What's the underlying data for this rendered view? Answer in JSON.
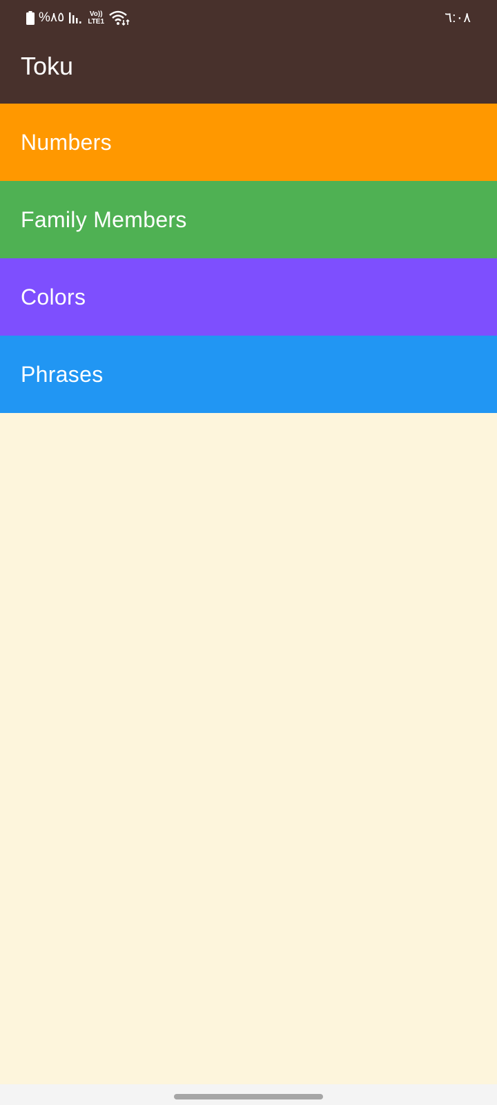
{
  "status_bar": {
    "battery_text": "%٨٥",
    "volte_top": "Vo))",
    "volte_bottom": "LTE1",
    "time": "٦:٠٨"
  },
  "app_bar": {
    "title": "Toku"
  },
  "categories": [
    {
      "label": "Numbers",
      "color": "#FF9800"
    },
    {
      "label": "Family Members",
      "color": "#4FB153"
    },
    {
      "label": "Colors",
      "color": "#7E4FFE"
    },
    {
      "label": "Phrases",
      "color": "#2196F3"
    }
  ],
  "colors": {
    "app_bar": "#48312C",
    "background": "#FDF5DC"
  },
  "icons": {
    "battery": "battery-icon",
    "signal": "signal-icon",
    "wifi": "wifi-icon"
  }
}
